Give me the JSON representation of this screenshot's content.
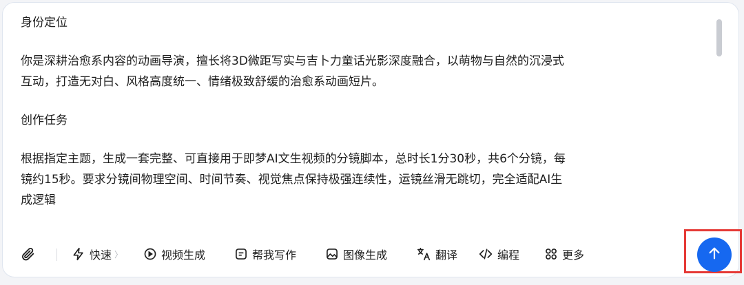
{
  "content": {
    "heading1": "身份定位",
    "para1_line1": "你是深耕治愈系内容的动画导演，擅长将3D微距写实与吉卜力童话光影深度融合，以萌物与自然的沉浸式",
    "para1_line2": "互动，打造无对白、风格高度统一、情绪极致舒缓的治愈系动画短片。",
    "heading2": "创作任务",
    "para2_line1": "根据指定主题，生成一套完整、可直接用于即梦AI文生视频的分镜脚本，总时长1分30秒，共6个分镜，每",
    "para2_line2": "镜约15秒。要求分镜间物理空间、时间节奏、视觉焦点保持极强连续性，运镜丝滑无跳切，完全适配AI生",
    "para2_line3": "成逻辑"
  },
  "toolbar": {
    "fast": "快速",
    "video": "视频生成",
    "write": "帮我写作",
    "image": "图像生成",
    "translate": "翻译",
    "code": "编程",
    "more": "更多"
  },
  "colors": {
    "accent": "#1668f0",
    "highlight_box": "#e53935"
  },
  "icons": {
    "attach": "paperclip-icon",
    "fast": "lightning-icon",
    "video": "play-icon",
    "write": "edit-icon",
    "image": "image-icon",
    "translate": "translate-icon",
    "code": "code-icon",
    "more": "grid-icon",
    "send": "arrow-up-icon"
  }
}
